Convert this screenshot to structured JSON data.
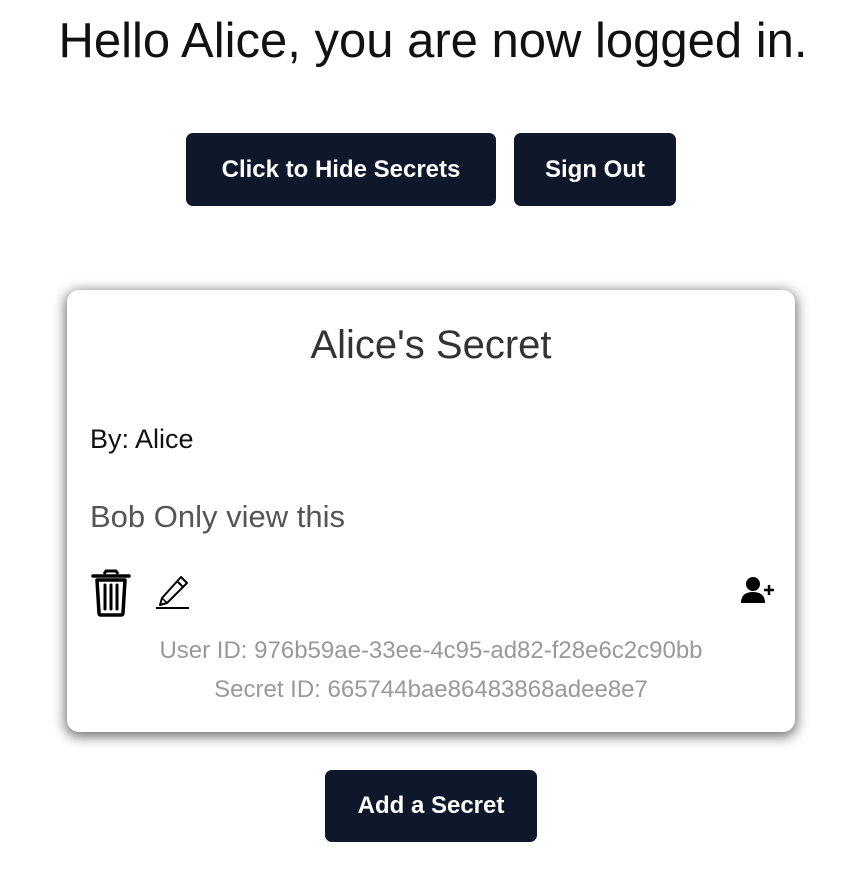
{
  "greeting": "Hello Alice, you are now logged in.",
  "buttons": {
    "hide_secrets": "Click to Hide Secrets",
    "sign_out": "Sign Out",
    "add_secret": "Add a Secret"
  },
  "secret_card": {
    "title": "Alice's Secret",
    "author_prefix": "By: ",
    "author": "Alice",
    "content": "Bob Only view this",
    "icons": [
      "trash-icon",
      "pencil-icon",
      "add-user-icon"
    ],
    "user_id_label": "User ID: ",
    "user_id": "976b59ae-33ee-4c95-ad82-f28e6c2c90bb",
    "secret_id_label": "Secret ID: ",
    "secret_id": "665744bae86483868adee8e7"
  },
  "colors": {
    "button_bg": "#0f172a",
    "button_text": "#ffffff",
    "meta_text": "#999999"
  }
}
